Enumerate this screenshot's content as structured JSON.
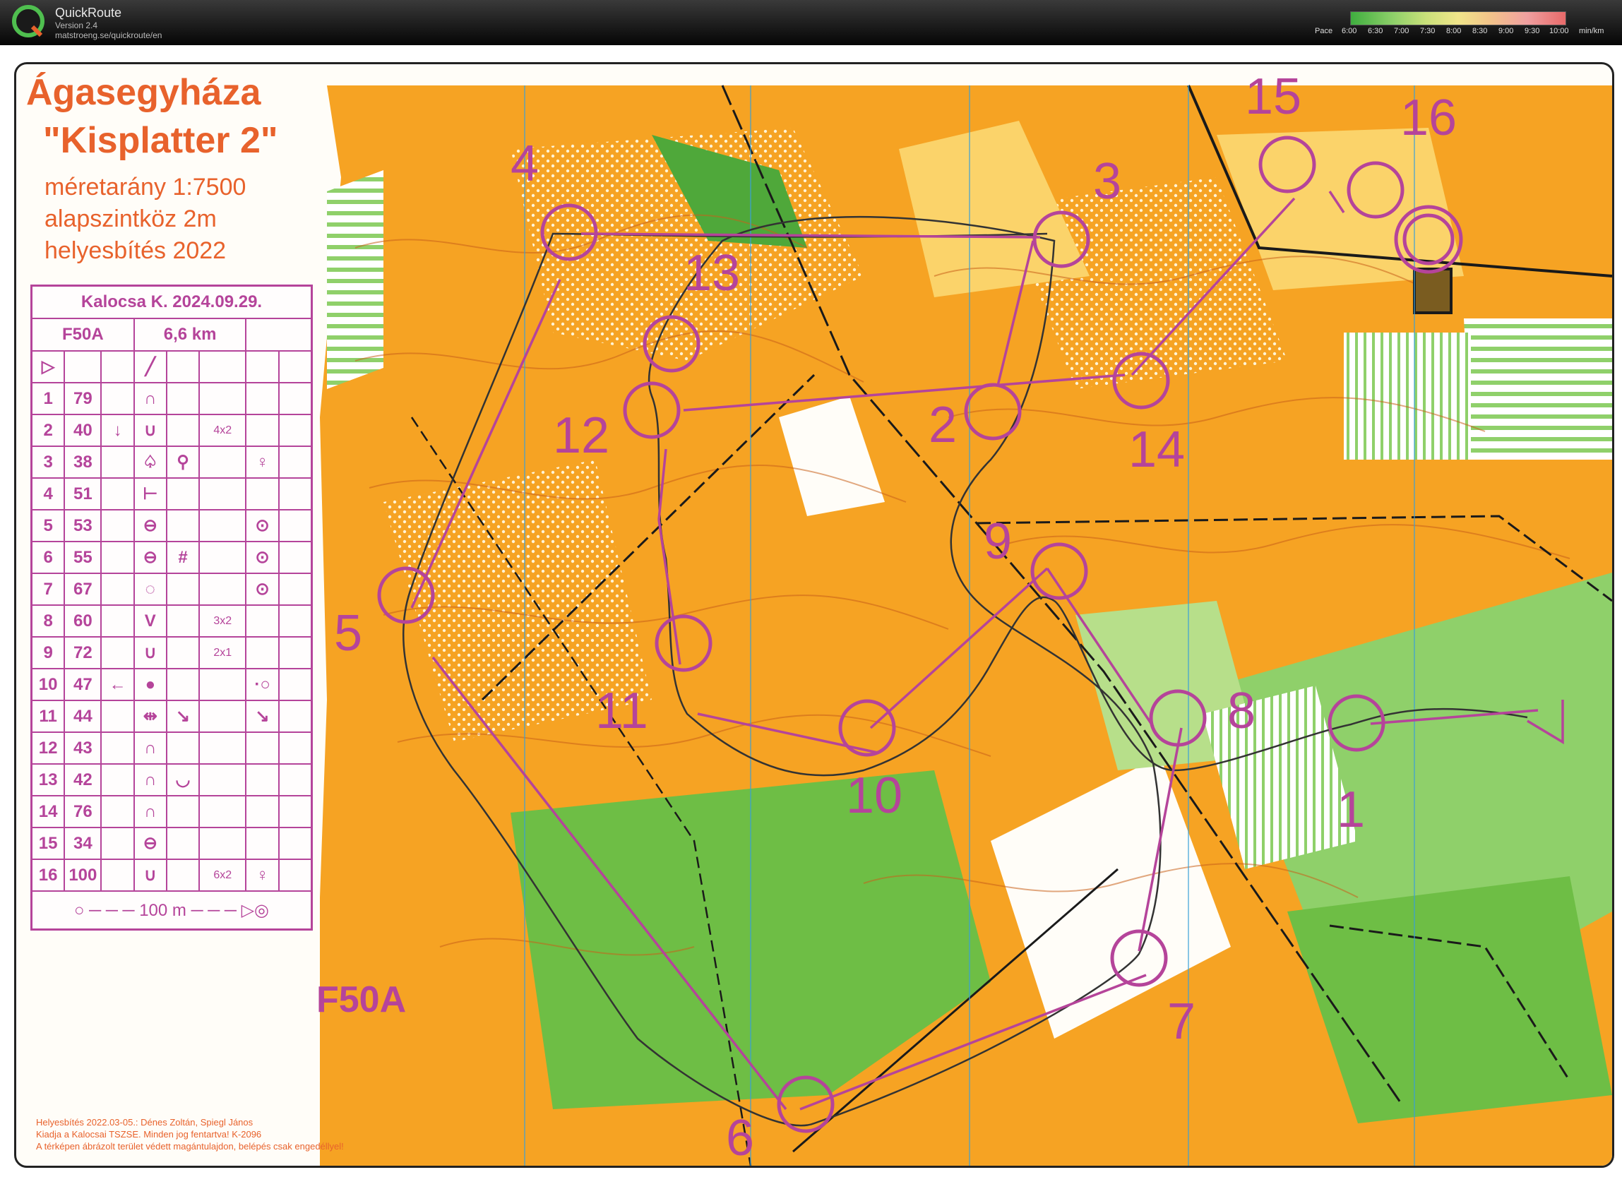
{
  "app": {
    "name": "QuickRoute",
    "version": "Version 2.4",
    "url": "matstroeng.se/quickroute/en",
    "logo_letter": "Q"
  },
  "pace_legend": {
    "label": "Pace",
    "ticks": [
      "6:00",
      "6:30",
      "7:00",
      "7:30",
      "8:00",
      "8:30",
      "9:00",
      "9:30",
      "10:00"
    ],
    "unit": "min/km"
  },
  "map": {
    "title": "Ágasegyháza",
    "subtitle": "\"Kisplatter 2\"",
    "scale_line": "méretarány  1:7500",
    "contour_line": "alapszintköz  2m",
    "revision_line": "helyesbítés  2022",
    "course_label": "F50A",
    "colors": {
      "forest_open": "#f6a323",
      "rough_open": "#fbd36a",
      "vegetation_green": "#6ebe45",
      "course_purple": "#b5449a",
      "route_dark": "#3a3a3a",
      "contour_brown": "#d2691e"
    },
    "footer_notes": [
      "Helyesbítés 2022.03-05.: Dénes Zoltán, Spiegl János",
      "Kiadja a Kalocsai TSZSE. Minden jog fentartva! K-2096",
      "A térképen ábrázolt terület védett magántulajdon, belépés csak engedéllyel!"
    ],
    "control_numbers": [
      "1",
      "2",
      "3",
      "4",
      "5",
      "6",
      "7",
      "8",
      "9",
      "10",
      "11",
      "12",
      "13",
      "14",
      "15",
      "16"
    ]
  },
  "description_sheet": {
    "event": "Kalocsa K. 2024.09.29.",
    "class": "F50A",
    "length": "6,6 km",
    "start_symbol": "▷",
    "rows": [
      {
        "num": "1",
        "code": "79",
        "dir": "",
        "feat": "∩",
        "detail": "",
        "dim": "",
        "loc": ""
      },
      {
        "num": "2",
        "code": "40",
        "dir": "↓",
        "feat": "∪",
        "detail": "",
        "dim": "4x2",
        "loc": ""
      },
      {
        "num": "3",
        "code": "38",
        "dir": "",
        "feat": "♤",
        "detail": "⚲",
        "dim": "",
        "loc": "♀"
      },
      {
        "num": "4",
        "code": "51",
        "dir": "",
        "feat": "⊢",
        "detail": "",
        "dim": "",
        "loc": ""
      },
      {
        "num": "5",
        "code": "53",
        "dir": "",
        "feat": "⊖",
        "detail": "",
        "dim": "",
        "loc": "⊙"
      },
      {
        "num": "6",
        "code": "55",
        "dir": "",
        "feat": "⊖",
        "detail": "#",
        "dim": "",
        "loc": "⊙"
      },
      {
        "num": "7",
        "code": "67",
        "dir": "",
        "feat": "◌",
        "detail": "",
        "dim": "",
        "loc": "⊙"
      },
      {
        "num": "8",
        "code": "60",
        "dir": "",
        "feat": "V",
        "detail": "",
        "dim": "3x2",
        "loc": ""
      },
      {
        "num": "9",
        "code": "72",
        "dir": "",
        "feat": "∪",
        "detail": "",
        "dim": "2x1",
        "loc": ""
      },
      {
        "num": "10",
        "code": "47",
        "dir": "←",
        "feat": "●",
        "detail": "",
        "dim": "",
        "loc": "·○"
      },
      {
        "num": "11",
        "code": "44",
        "dir": "",
        "feat": "⇹",
        "detail": "↘",
        "dim": "",
        "loc": "↘"
      },
      {
        "num": "12",
        "code": "43",
        "dir": "",
        "feat": "∩",
        "detail": "",
        "dim": "",
        "loc": ""
      },
      {
        "num": "13",
        "code": "42",
        "dir": "",
        "feat": "∩",
        "detail": "◡",
        "dim": "",
        "loc": ""
      },
      {
        "num": "14",
        "code": "76",
        "dir": "",
        "feat": "∩",
        "detail": "",
        "dim": "",
        "loc": ""
      },
      {
        "num": "15",
        "code": "34",
        "dir": "",
        "feat": "⊖",
        "detail": "",
        "dim": "",
        "loc": ""
      },
      {
        "num": "16",
        "code": "100",
        "dir": "",
        "feat": "∪",
        "detail": "",
        "dim": "6x2",
        "loc": "♀"
      }
    ],
    "finish_line": "100 m"
  }
}
